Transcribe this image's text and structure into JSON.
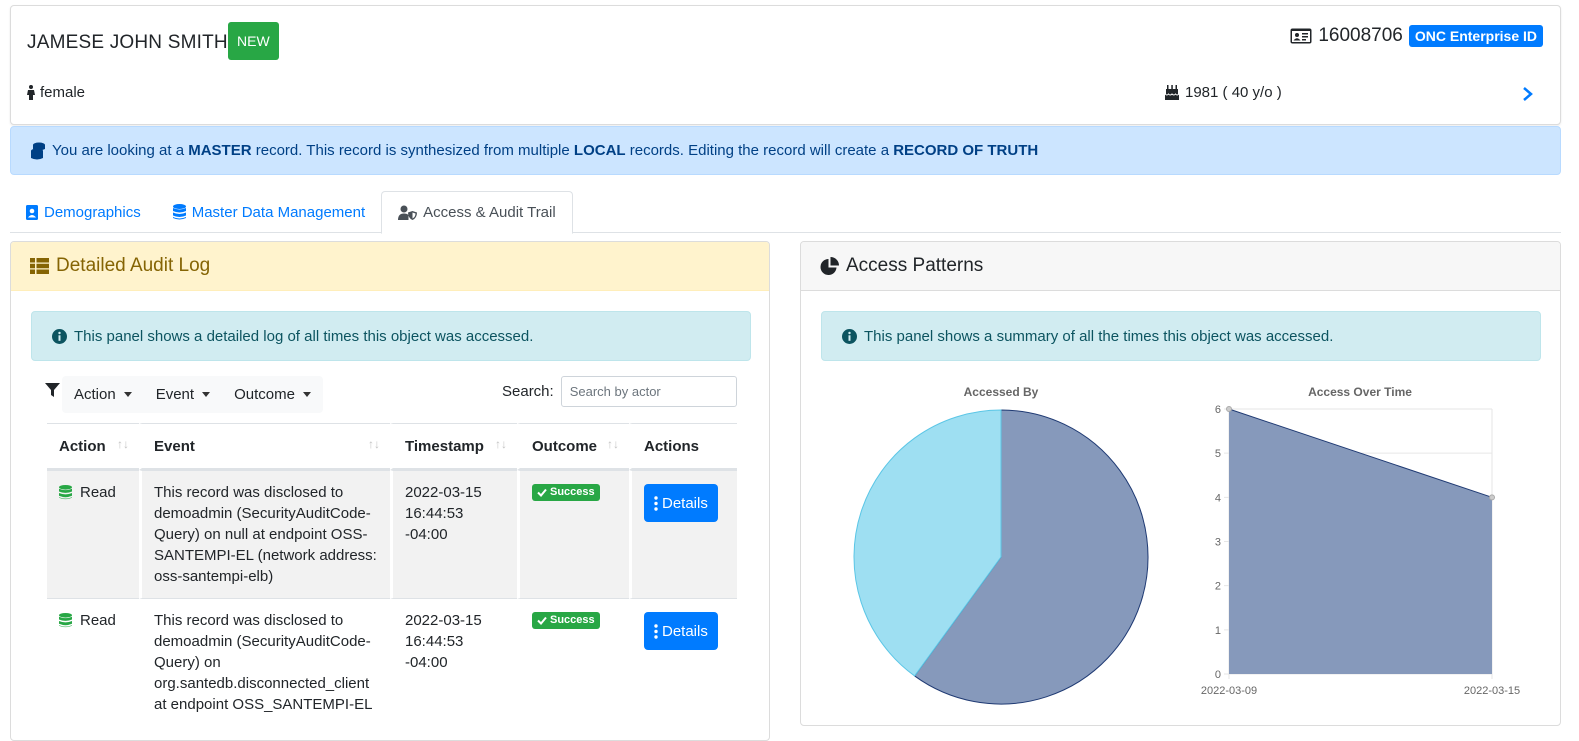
{
  "header": {
    "patient_name": "JAMESE JOHN SMITH",
    "new_badge": "NEW",
    "gender": "female",
    "enterprise_id": "16008706",
    "enterprise_id_label": "ONC Enterprise ID",
    "birth": "1981 ( 40 y/o )"
  },
  "master_alert": {
    "p1": "You are looking at a ",
    "b1": "MASTER",
    "p2": " record. This record is synthesized from multiple ",
    "b2": "LOCAL",
    "p3": " records. Editing the record will create a ",
    "b3": "RECORD OF TRUTH"
  },
  "tabs": [
    {
      "label": "Demographics",
      "icon": "id-badge-icon"
    },
    {
      "label": "Master Data Management",
      "icon": "database-icon"
    },
    {
      "label": "Access & Audit Trail",
      "icon": "user-shield-icon",
      "active": true
    }
  ],
  "audit": {
    "title": "Detailed Audit Log",
    "info": "This panel shows a detailed log of all times this object was accessed.",
    "filters": [
      "Action",
      "Event",
      "Outcome"
    ],
    "search_label": "Search:",
    "search_placeholder": "Search by actor",
    "columns": [
      "Action",
      "Event",
      "Timestamp",
      "Outcome",
      "Actions"
    ],
    "rows": [
      {
        "action": "Read",
        "event": "This record was disclosed to demoadmin (SecurityAuditCode-Query) on null at endpoint OSS-SANTEMPI-EL (network address: oss-santempi-elb)",
        "timestamp": "2022-03-15 16:44:53 -04:00",
        "outcome": "Success",
        "button": "Details"
      },
      {
        "action": "Read",
        "event": "This record was disclosed to demoadmin (SecurityAuditCode-Query) on org.santedb.disconnected_client at endpoint OSS_SANTEMPI-EL",
        "timestamp": "2022-03-15 16:44:53 -04:00",
        "outcome": "Success",
        "button": "Details"
      }
    ]
  },
  "patterns": {
    "title": "Access Patterns",
    "info": "This panel shows a summary of all the times this object was accessed."
  },
  "chart_data": [
    {
      "type": "pie",
      "title": "Accessed By",
      "labels": [
        "",
        ""
      ],
      "values": [
        0.6,
        0.4
      ],
      "colors": [
        "#8699bb",
        "#9edff2"
      ]
    },
    {
      "type": "area",
      "title": "Access Over Time",
      "x": [
        "2022-03-09",
        "2022-03-15"
      ],
      "values": [
        6,
        4
      ],
      "ylim": [
        0,
        6
      ],
      "yticks": [
        0,
        1,
        2,
        3,
        4,
        5,
        6
      ],
      "fill": "#8699bb",
      "line": "#1f3a73"
    }
  ]
}
